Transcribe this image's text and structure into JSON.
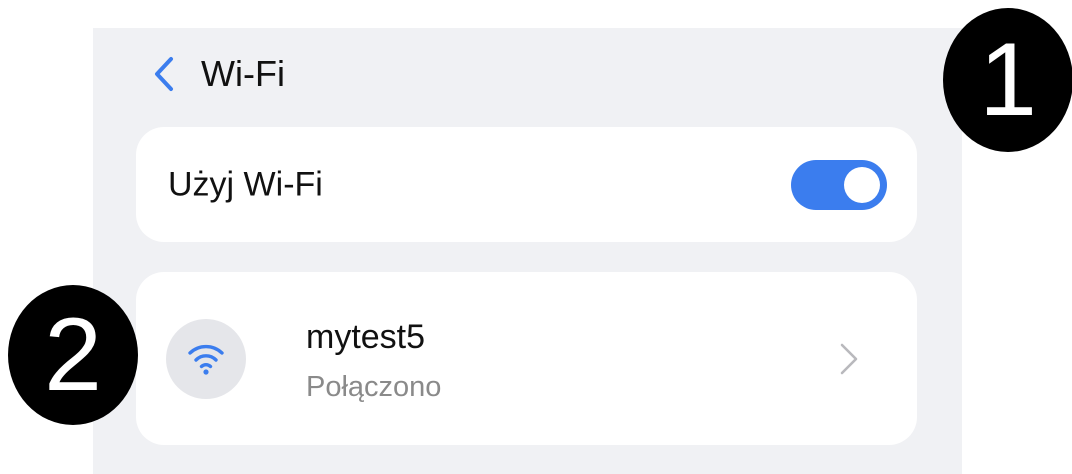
{
  "header": {
    "back_icon": "chevron-left-icon",
    "title": "Wi-Fi"
  },
  "wifi_toggle": {
    "label": "Użyj Wi-Fi",
    "enabled": true
  },
  "network": {
    "icon": "wifi-icon",
    "name": "mytest5",
    "status": "Połączono",
    "chevron_icon": "chevron-right-icon"
  },
  "annotations": {
    "badge_1": "1",
    "badge_2": "2"
  },
  "colors": {
    "accent": "#3b7dee",
    "background": "#f0f1f4",
    "card": "#ffffff"
  }
}
